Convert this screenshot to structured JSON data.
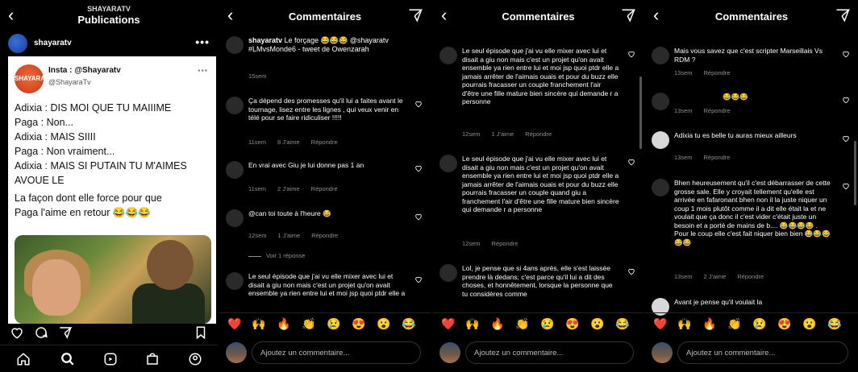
{
  "panel1": {
    "kicker": "SHAYARATV",
    "title": "Publications",
    "username": "shayaratv",
    "tweet": {
      "avatar_text": "SHAYARA",
      "name": "Insta : @Shayaratv",
      "handle": "@ShayaraTv",
      "lines": [
        "Adixia : DIS MOI QUE TU MAIIIME",
        "Paga : Non...",
        "Adixia : MAIS SIIII",
        "Paga : Non vraiment...",
        "Adixia : MAIS SI PUTAIN TU M'AIMES",
        "AVOUE LE"
      ],
      "caption_1": "La façon dont elle force pour que",
      "caption_2": "Paga l'aime en retour 😂😂😂"
    }
  },
  "comments_title": "Commentaires",
  "input_placeholder": "Ajoutez un commentaire...",
  "emojis": [
    "❤️",
    "🙌",
    "🔥",
    "👏",
    "😢",
    "😍",
    "😮",
    "😂"
  ],
  "panel2": {
    "caption": {
      "user": "shayaratv",
      "text": "Le forçage 😂😂😂 @shayaratv #LMvsMonde6 - tweet de Owenzarah",
      "time": "15sem"
    },
    "comments": [
      {
        "text": "Ça dépend des promesses qu'il lui a faites avant le tournage, lisez entre les lignes , qui veux venir en télé pour se faire ridiculiser !!!!!",
        "time": "11sem",
        "likes": "8 J'aime",
        "reply": "Répondre"
      },
      {
        "text": "En vrai avec Giu je lui donne pas 1 an",
        "time": "11sem",
        "likes": "2 J'aime",
        "reply": "Répondre"
      },
      {
        "text": "@can toi toute à l'heure 😂",
        "time": "12sem",
        "likes": "1 J'aime",
        "reply": "Répondre"
      },
      {
        "text": "Le seul épisode que j'ai vu elle mixer avec lui et disait a giu non mais c'est un projet qu'on avait ensemble ya rien entre lui et moi jsp quoi ptdr elle a"
      }
    ],
    "view_replies": "Voir 1 réponse"
  },
  "panel3": {
    "comments": [
      {
        "text": "Le seul épisode que j'ai vu elle mixer avec lui et disait a giu non mais c'est un projet qu'on avait ensemble ya rien entre lui et moi jsp quoi ptdr elle a jamais arrêter de l'aimais ouais et pour du buzz elle pourrais fracasser un couple franchement l'air d'être une fille mature bien sincère qui demande r a personne",
        "time": "12sem",
        "likes": "1 J'aime",
        "reply": "Répondre"
      },
      {
        "text": "Le seul épisode que j'ai vu elle mixer avec lui et disait a giu non mais c'est un projet qu'on avait ensemble ya rien entre lui et moi jsp quoi ptdr elle a jamais arrêter de l'aimais ouais et pour du buzz elle pourrais fracasser un couple quand giu a franchement l'air d'être une fille mature bien sincère qui demande r a personne",
        "time": "12sem",
        "reply": "Répondre"
      },
      {
        "text": "Lol, je pense que si 4ans après, elle s'est laissée prendre là dedans; c'est parce qu'il lui a dit des choses, et honnêtement, lorsque la personne que tu considères comme"
      }
    ]
  },
  "panel4": {
    "comments": [
      {
        "text": "Mais vous savez que c'est scripter Marseillais Vs RDM ?",
        "time": "13sem",
        "reply": "Répondre"
      },
      {
        "text": "😂😂😂",
        "time": "13sem",
        "reply": "Répondre"
      },
      {
        "text": "Adixia tu es belle tu auras mieux ailleurs",
        "time": "13sem",
        "reply": "Répondre"
      },
      {
        "text": "Bhen heureusement qu'il c'est débarrasser de cette grosse sale. Elle y croyait tellement qu'elle est arrivée en fafaronant bhen non il la juste niquer un coup 1 mois plutôt comme il a dit elle était la et ne voulait que ça donc il c'est vider c'était juste un besoin et a porté de mains de b.... 😂😂😂😂 . Pour le coup elle c'est fait niquer bien bien 😂😂😂 😂😂",
        "time": "13sem",
        "likes": "2 J'aime",
        "reply": "Répondre"
      },
      {
        "text": "Avant je pense qu'il voulait la"
      }
    ]
  }
}
